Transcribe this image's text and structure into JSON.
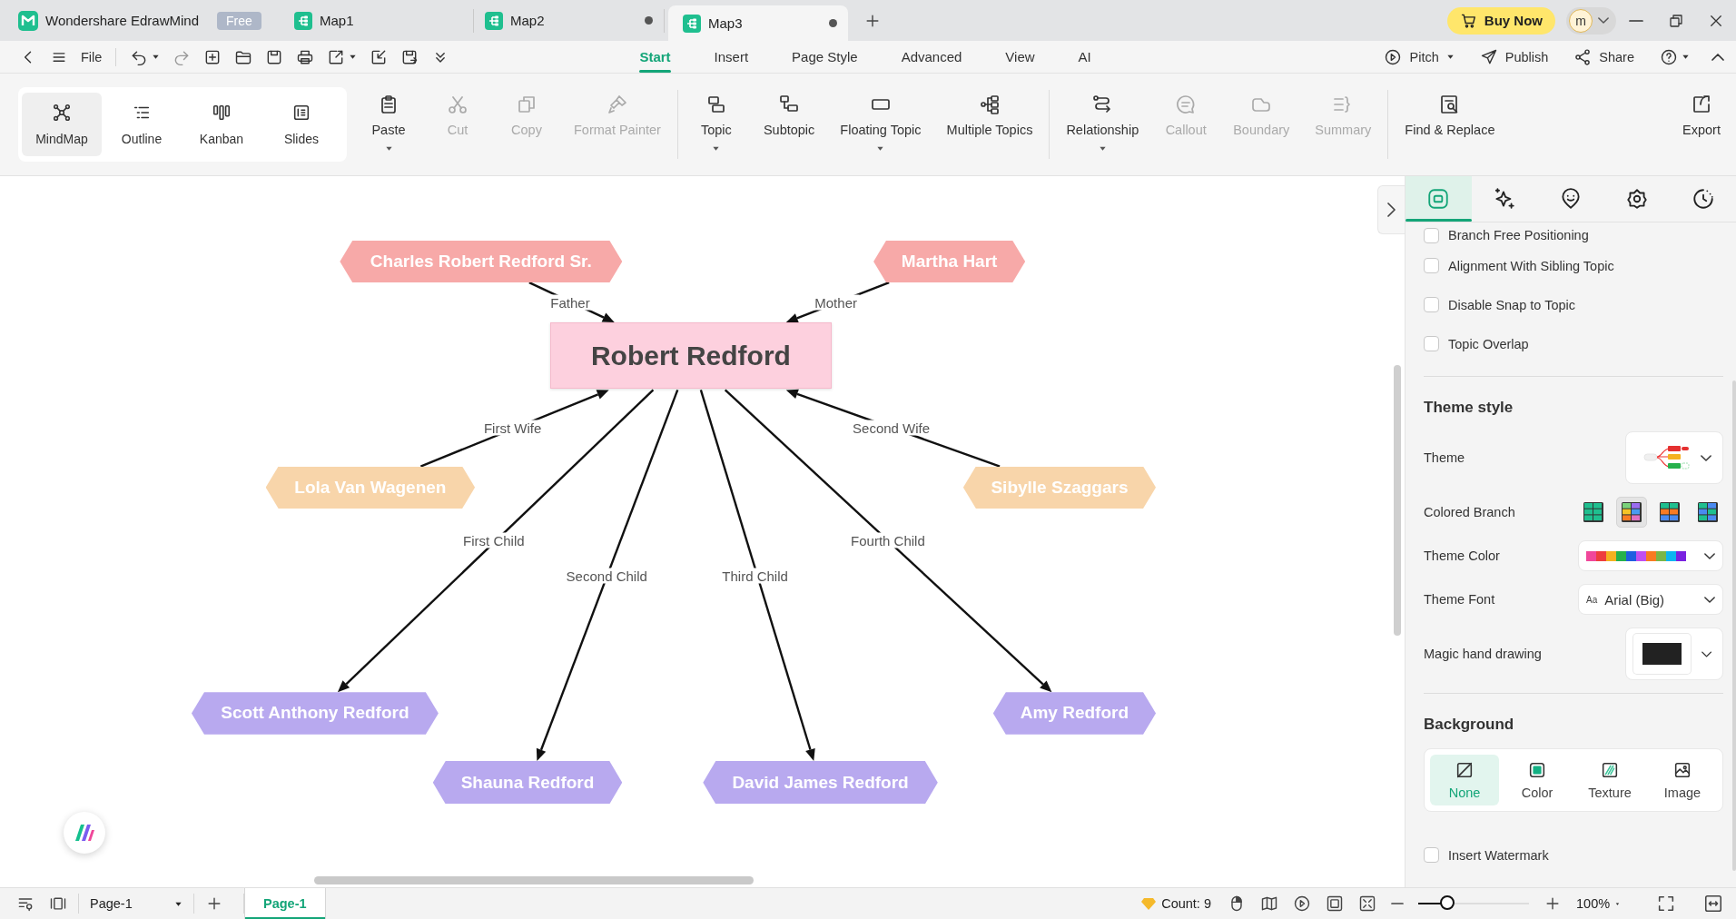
{
  "app": {
    "name": "Wondershare EdrawMind",
    "badge": "Free"
  },
  "doc_tabs": [
    {
      "label": "Map1",
      "selected": false,
      "unsaved": false
    },
    {
      "label": "Map2",
      "selected": false,
      "unsaved": true
    },
    {
      "label": "Map3",
      "selected": true,
      "unsaved": true
    }
  ],
  "buy_button": "Buy Now",
  "avatar": "m",
  "file_menu": "File",
  "menu_tabs": [
    {
      "label": "Start",
      "selected": true
    },
    {
      "label": "Insert",
      "selected": false
    },
    {
      "label": "Page Style",
      "selected": false
    },
    {
      "label": "Advanced",
      "selected": false
    },
    {
      "label": "View",
      "selected": false
    },
    {
      "label": "AI",
      "selected": false
    }
  ],
  "menu_actions": [
    {
      "label": "Pitch",
      "dropdown": true
    },
    {
      "label": "Publish",
      "dropdown": false
    },
    {
      "label": "Share",
      "dropdown": false
    }
  ],
  "view_modes": [
    {
      "label": "MindMap",
      "selected": true
    },
    {
      "label": "Outline",
      "selected": false
    },
    {
      "label": "Kanban",
      "selected": false
    },
    {
      "label": "Slides",
      "selected": false
    }
  ],
  "ribbon_groups": [
    [
      {
        "label": "Paste",
        "disabled": false,
        "dropdown": true
      },
      {
        "label": "Cut",
        "disabled": true,
        "dropdown": false
      },
      {
        "label": "Copy",
        "disabled": true,
        "dropdown": false
      },
      {
        "label": "Format Painter",
        "disabled": true,
        "dropdown": false
      }
    ],
    [
      {
        "label": "Topic",
        "disabled": false,
        "dropdown": true
      },
      {
        "label": "Subtopic",
        "disabled": false,
        "dropdown": false
      },
      {
        "label": "Floating Topic",
        "disabled": false,
        "dropdown": true
      },
      {
        "label": "Multiple Topics",
        "disabled": false,
        "dropdown": false
      }
    ],
    [
      {
        "label": "Relationship",
        "disabled": false,
        "dropdown": true
      },
      {
        "label": "Callout",
        "disabled": true,
        "dropdown": false
      },
      {
        "label": "Boundary",
        "disabled": true,
        "dropdown": false
      },
      {
        "label": "Summary",
        "disabled": true,
        "dropdown": false
      }
    ],
    [
      {
        "label": "Find & Replace",
        "disabled": false,
        "dropdown": false
      }
    ]
  ],
  "export_button": "Export",
  "mind_map": {
    "nodes": [
      {
        "text": "Robert Redford",
        "kind": "center"
      },
      {
        "text": "Charles Robert Redford Sr.",
        "kind": "parent",
        "relation": "Father",
        "arrow_to_center": true
      },
      {
        "text": "Martha Hart",
        "kind": "parent",
        "relation": "Mother",
        "arrow_to_center": true
      },
      {
        "text": "Lola Van Wagenen",
        "kind": "spouse",
        "relation": "First Wife",
        "arrow_to_center": true
      },
      {
        "text": "Sibylle Szaggars",
        "kind": "spouse",
        "relation": "Second Wife",
        "arrow_to_center": true
      },
      {
        "text": "Scott Anthony Redford",
        "kind": "child",
        "relation": "First Child",
        "arrow_to_center": false
      },
      {
        "text": "Shauna Redford",
        "kind": "child",
        "relation": "Second Child",
        "arrow_to_center": false
      },
      {
        "text": "David James Redford",
        "kind": "child",
        "relation": "Third Child",
        "arrow_to_center": false
      },
      {
        "text": "Amy Redford",
        "kind": "child",
        "relation": "Fourth Child",
        "arrow_to_center": false
      }
    ]
  },
  "panel": {
    "tabs": [
      {
        "selected": true
      },
      {
        "selected": false
      },
      {
        "selected": false
      },
      {
        "selected": false
      },
      {
        "selected": false
      }
    ],
    "options": [
      {
        "label": "Branch Free Positioning",
        "checked": false
      },
      {
        "label": "Alignment With Sibling Topic",
        "checked": false
      },
      {
        "label": "Disable Snap to Topic",
        "checked": false
      },
      {
        "label": "Topic Overlap",
        "checked": false
      }
    ],
    "theme_style": {
      "title": "Theme style",
      "theme_label": "Theme",
      "branch_label": "Colored Branch",
      "branch_options": [
        {
          "selected": false
        },
        {
          "selected": true
        },
        {
          "selected": false
        },
        {
          "selected": false
        }
      ],
      "color_label": "Theme Color",
      "colors": [
        {
          "color": "#f0479a"
        },
        {
          "color": "#ee3e3e"
        },
        {
          "color": "#f5b120"
        },
        {
          "color": "#26b14c"
        },
        {
          "color": "#1f5fe0"
        },
        {
          "color": "#c04ff0"
        },
        {
          "color": "#f97b22"
        },
        {
          "color": "#7ab648"
        },
        {
          "color": "#0eb5f0"
        },
        {
          "color": "#7a22e0"
        }
      ],
      "font_label": "Theme Font",
      "font_sample": "Aa",
      "font_value": "Arial (Big)",
      "drawing_label": "Magic hand drawing",
      "pen": {
        "color": "#222222"
      }
    },
    "background": {
      "title": "Background",
      "options": [
        {
          "label": "None",
          "selected": true
        },
        {
          "label": "Color",
          "selected": false
        },
        {
          "label": "Texture",
          "selected": false
        },
        {
          "label": "Image",
          "selected": false
        }
      ]
    },
    "watermark": {
      "label": "Insert Watermark",
      "checked": false
    }
  },
  "status_bar": {
    "page_select": "Page-1",
    "pages": [
      {
        "label": "Page-1",
        "selected": true
      }
    ],
    "count": "Count: 9",
    "zoom": {
      "level": 0.26,
      "reading": "100%"
    }
  }
}
